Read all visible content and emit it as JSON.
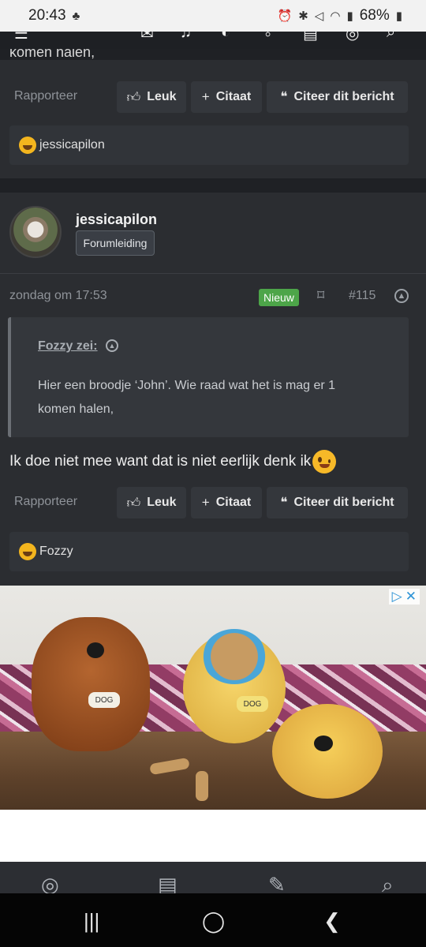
{
  "status_bar": {
    "time": "20:43",
    "battery": "68%"
  },
  "scrolled_text": "komen halen,",
  "post1": {
    "report_label": "Rapporteer",
    "like_label": "Leuk",
    "quote_label": "Citaat",
    "cite_label": "Citeer dit bericht",
    "reaction_user": "jessicapilon"
  },
  "post2": {
    "username": "jessicapilon",
    "role": "Forumleiding",
    "date": "zondag om 17:53",
    "new_badge": "Nieuw",
    "post_number": "#115",
    "quote": {
      "author": "Fozzy zei:",
      "text": "Hier een broodje ‘John’. Wie raad wat het is mag er 1 komen halen,"
    },
    "body": "Ik doe niet mee want dat is niet eerlijk denk ik",
    "report_label": "Rapporteer",
    "like_label": "Leuk",
    "quote_label": "Citaat",
    "cite_label": "Citeer dit bericht",
    "reaction_user": "Fozzy"
  },
  "ad": {
    "dog_tag_1": "DOG",
    "dog_tag_2": "DOG"
  },
  "icons": {
    "like": "thumbs-up-icon",
    "plus": "plus-icon",
    "cite": "quote-marks-icon",
    "bookmark": "bookmark-icon",
    "share_up": "arrow-up-circle-icon"
  },
  "colors": {
    "background": "#2b2d31",
    "new_badge": "#4da549",
    "ad_close": "#2d93d6"
  }
}
